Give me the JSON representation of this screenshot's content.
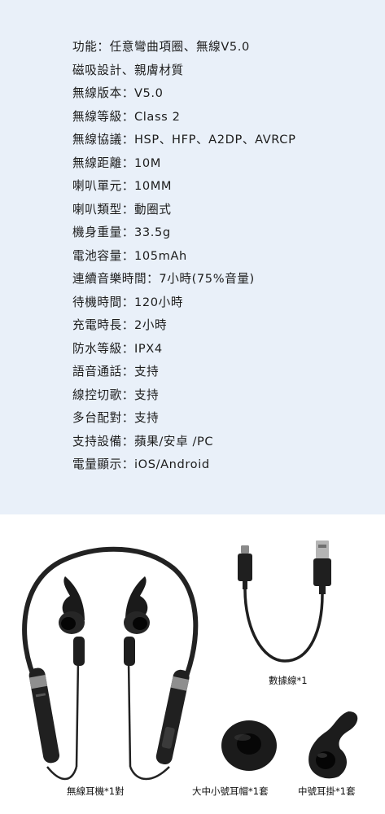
{
  "specs": [
    "功能：任意彎曲項圈、無線V5.0",
    "磁吸設計、親膚材質",
    "無線版本：V5.0",
    "無線等級：Class 2",
    "無線協議：HSP、HFP、A2DP、AVRCP",
    "無線距離：10M",
    "喇叭單元：10MM",
    "喇叭類型：動圈式",
    "機身重量：33.5g",
    "電池容量：105mAh",
    "連續音樂時間：7小時(75%音量)",
    "待機時間：120小時",
    "充電時長：2小時",
    "防水等級：IPX4",
    "語音通話：支持",
    "線控切歌：支持",
    "多台配對：支持",
    "支持設備：蘋果/安卓 /PC",
    "電量顯示：iOS/Android"
  ],
  "products": {
    "headset_caption": "無線耳機*1對",
    "cable_caption": "數據線*1",
    "eartips_caption": "大中小號耳帽*1套",
    "earhook_caption": "中號耳掛*1套"
  },
  "colors": {
    "spec_background": "#e9f0f9",
    "product_body": "#222222"
  }
}
